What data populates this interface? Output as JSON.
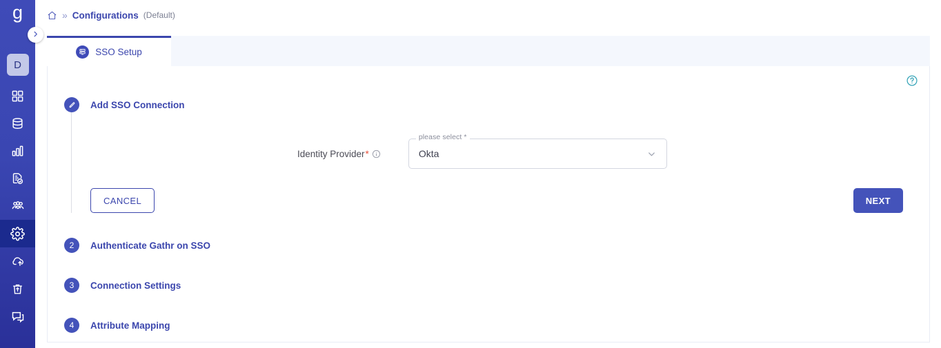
{
  "brand": {
    "logo_text": "g",
    "sidebar_bg_top": "#3f4bb8",
    "sidebar_bg_bottom": "#2a3099",
    "accent": "#3b46ad",
    "active_item_bg": "#1b2a8e",
    "required_color": "#e8513d",
    "help_icon_color": "#3aa6b9"
  },
  "sidebar": {
    "avatar_label": "D",
    "items": [
      {
        "icon": "grid-icon",
        "name": "sidebar-item-dashboard",
        "active": false
      },
      {
        "icon": "database-icon",
        "name": "sidebar-item-data",
        "active": false
      },
      {
        "icon": "bar-chart-icon",
        "name": "sidebar-item-analytics",
        "active": false
      },
      {
        "icon": "document-check-icon",
        "name": "sidebar-item-reports",
        "active": false
      },
      {
        "icon": "users-icon",
        "name": "sidebar-item-users",
        "active": false
      },
      {
        "icon": "gear-icon",
        "name": "sidebar-item-settings",
        "active": true
      },
      {
        "icon": "cloud-upload-icon",
        "name": "sidebar-item-deploy",
        "active": false
      },
      {
        "icon": "trash-icon",
        "name": "sidebar-item-trash",
        "active": false
      },
      {
        "icon": "chat-icon",
        "name": "sidebar-item-support",
        "active": false
      }
    ],
    "collapse_toggle_icon": "chevron-right-icon"
  },
  "breadcrumb": {
    "home_icon": "home-icon",
    "separator": "»",
    "title": "Configurations",
    "subtitle": "(Default)"
  },
  "tabs": [
    {
      "label": "SSO Setup",
      "icon": "server-stack-icon",
      "active": true
    }
  ],
  "card": {
    "help_icon": "help-circle-icon"
  },
  "stepper": {
    "steps": [
      {
        "marker": "pencil-icon",
        "marker_text": "",
        "title": "Add SSO Connection",
        "active": true
      },
      {
        "marker": "number",
        "marker_text": "2",
        "title": "Authenticate Gathr on SSO",
        "active": false
      },
      {
        "marker": "number",
        "marker_text": "3",
        "title": "Connection Settings",
        "active": false
      },
      {
        "marker": "number",
        "marker_text": "4",
        "title": "Attribute Mapping",
        "active": false
      }
    ]
  },
  "form": {
    "identity_provider": {
      "label": "Identity Provider",
      "required_mark": "*",
      "info_icon": "info-icon",
      "float_label": "please select *",
      "value": "Okta",
      "chevron_icon": "chevron-down-icon"
    }
  },
  "actions": {
    "cancel_label": "CANCEL",
    "next_label": "NEXT"
  }
}
